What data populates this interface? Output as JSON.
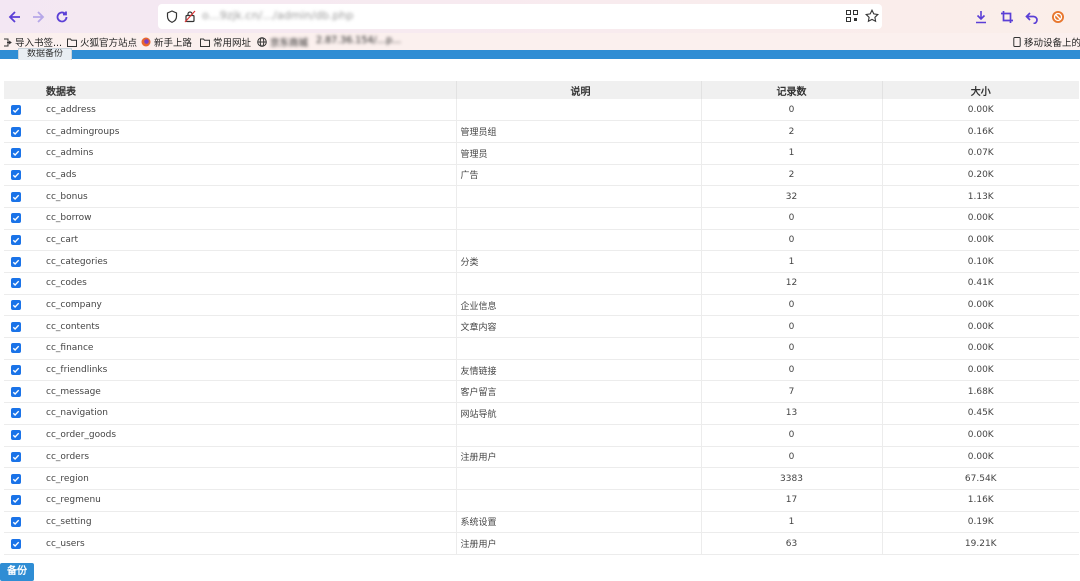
{
  "browser": {
    "url": "o…9zjk.cn/…/admin/db.php",
    "bookmarks": [
      "导入书签...",
      "火狐官方站点",
      "新手上路",
      "常用网址",
      "京东商城",
      "2.87.36.154/…p..."
    ],
    "bookmark_right": "移动设备上的书",
    "accent_color": "#2f8dd4"
  },
  "tab": {
    "label": "数据备份"
  },
  "table": {
    "headers": {
      "name": "数据表",
      "desc": "说明",
      "count": "记录数",
      "size": "大小"
    },
    "rows": [
      {
        "name": "cc_address",
        "desc": "",
        "count": "0",
        "size": "0.00K",
        "checked": true
      },
      {
        "name": "cc_admingroups",
        "desc": "管理员组",
        "count": "2",
        "size": "0.16K",
        "checked": true
      },
      {
        "name": "cc_admins",
        "desc": "管理员",
        "count": "1",
        "size": "0.07K",
        "checked": true
      },
      {
        "name": "cc_ads",
        "desc": "广告",
        "count": "2",
        "size": "0.20K",
        "checked": true
      },
      {
        "name": "cc_bonus",
        "desc": "",
        "count": "32",
        "size": "1.13K",
        "checked": true
      },
      {
        "name": "cc_borrow",
        "desc": "",
        "count": "0",
        "size": "0.00K",
        "checked": true
      },
      {
        "name": "cc_cart",
        "desc": "",
        "count": "0",
        "size": "0.00K",
        "checked": true
      },
      {
        "name": "cc_categories",
        "desc": "分类",
        "count": "1",
        "size": "0.10K",
        "checked": true
      },
      {
        "name": "cc_codes",
        "desc": "",
        "count": "12",
        "size": "0.41K",
        "checked": true
      },
      {
        "name": "cc_company",
        "desc": "企业信息",
        "count": "0",
        "size": "0.00K",
        "checked": true
      },
      {
        "name": "cc_contents",
        "desc": "文章内容",
        "count": "0",
        "size": "0.00K",
        "checked": true
      },
      {
        "name": "cc_finance",
        "desc": "",
        "count": "0",
        "size": "0.00K",
        "checked": true
      },
      {
        "name": "cc_friendlinks",
        "desc": "友情链接",
        "count": "0",
        "size": "0.00K",
        "checked": true
      },
      {
        "name": "cc_message",
        "desc": "客户留言",
        "count": "7",
        "size": "1.68K",
        "checked": true
      },
      {
        "name": "cc_navigation",
        "desc": "网站导航",
        "count": "13",
        "size": "0.45K",
        "checked": true
      },
      {
        "name": "cc_order_goods",
        "desc": "",
        "count": "0",
        "size": "0.00K",
        "checked": true
      },
      {
        "name": "cc_orders",
        "desc": "注册用户",
        "count": "0",
        "size": "0.00K",
        "checked": true
      },
      {
        "name": "cc_region",
        "desc": "",
        "count": "3383",
        "size": "67.54K",
        "checked": true
      },
      {
        "name": "cc_regmenu",
        "desc": "",
        "count": "17",
        "size": "1.16K",
        "checked": true
      },
      {
        "name": "cc_setting",
        "desc": "系统设置",
        "count": "1",
        "size": "0.19K",
        "checked": true
      },
      {
        "name": "cc_users",
        "desc": "注册用户",
        "count": "63",
        "size": "19.21K",
        "checked": true
      }
    ]
  },
  "actions": {
    "backup_label": "备份"
  }
}
